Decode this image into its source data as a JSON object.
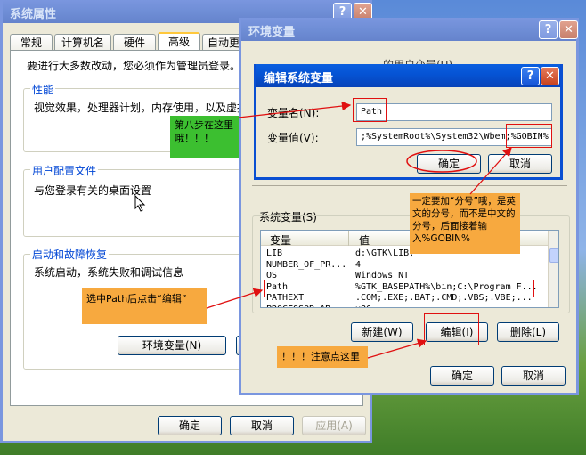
{
  "sys_props": {
    "title": "系统属性",
    "title_help": "?",
    "title_close": "✕",
    "tabs": [
      "常规",
      "计算机名",
      "硬件",
      "高级",
      "自动更新"
    ],
    "intro": "要进行大多数改动，您必须作为管理员登录。",
    "perf_title": "性能",
    "perf_text": "视觉效果，处理器计划，内存使用，以及虚拟",
    "profile_title": "用户配置文件",
    "profile_text": "与您登录有关的桌面设置",
    "startup_title": "启动和故障恢复",
    "startup_text": "系统启动，系统失败和调试信息",
    "env_button": "环境变量(N)",
    "ok": "确定",
    "cancel": "取消",
    "apply": "应用(A)"
  },
  "env_vars": {
    "title": "环境变量",
    "title_help": "?",
    "title_close": "✕",
    "user_vars_partial": "的用户变量(U)",
    "sys_vars_label": "系统变量(S)",
    "columns": [
      "变量",
      "值"
    ],
    "rows": [
      {
        "name": "LIB",
        "value": "d:\\GTK\\LIB;"
      },
      {
        "name": "NUMBER_OF_PR...",
        "value": "4"
      },
      {
        "name": "OS",
        "value": "Windows_NT"
      },
      {
        "name": "Path",
        "value": "%GTK_BASEPATH%\\bin;C:\\Program F..."
      },
      {
        "name": "PATHEXT",
        "value": ".COM;.EXE;.BAT;.CMD;.VBS;.VBE;..."
      },
      {
        "name": "PROCESSOR_AR...",
        "value": "x86"
      }
    ],
    "new_button": "新建(W)",
    "edit_button": "编辑(I)",
    "delete_button": "删除(L)",
    "ok": "确定",
    "cancel": "取消"
  },
  "edit_dialog": {
    "title": "编辑系统变量",
    "title_help": "?",
    "title_close": "✕",
    "name_label": "变量名(N):",
    "name_value": "Path",
    "value_label": "变量值(V):",
    "value_text": ";%SystemRoot%\\System32\\Wbem;%GOBIN%",
    "ok": "确定",
    "cancel": "取消"
  },
  "callouts": {
    "step8": "第八步在这里哦！！！",
    "semicolon": "一定要加“分号”哦，是英文的分号，而不是中文的分号，后面接着输入%GOBIN%",
    "select_path": "选中Path后点击“编辑”",
    "attention": "！！！注意点这里"
  },
  "colors": {
    "xp_blue": "#0a4fd2",
    "dialog_bg": "#ece9d8",
    "callout_orange": "#f7a93f",
    "callout_green": "#3cbf30",
    "annotation_red": "#e01010",
    "group_title_blue": "#0046d5"
  }
}
